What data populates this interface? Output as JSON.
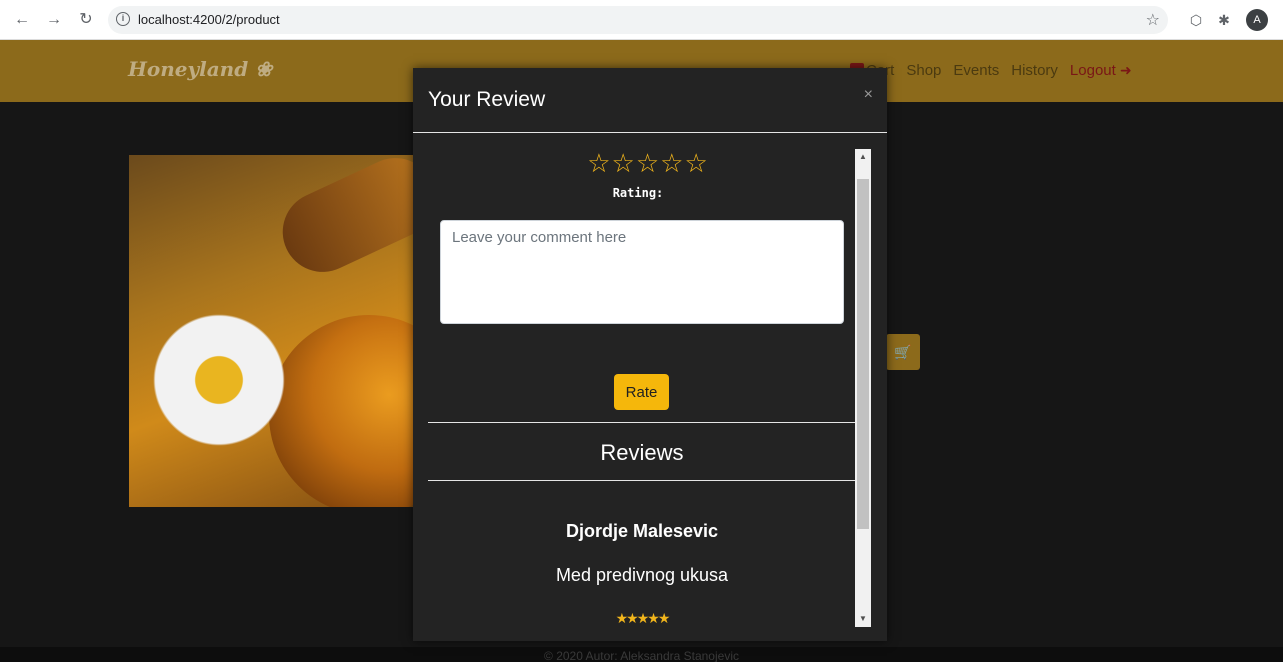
{
  "browser": {
    "url": "localhost:4200/2/product",
    "avatar_letter": "A"
  },
  "site": {
    "logo": "Honeyland",
    "nav": {
      "cart": "Cart",
      "shop": "Shop",
      "events": "Events",
      "history": "History",
      "logout": "Logout"
    },
    "footer": "© 2020 Autor: Aleksandra Stanojevic"
  },
  "modal": {
    "title": "Your Review",
    "close": "×",
    "stars": "☆☆☆☆☆",
    "rating_label": "Rating:",
    "comment_placeholder": "Leave your comment here",
    "rate_button": "Rate",
    "reviews_title": "Reviews",
    "reviews": [
      {
        "author": "Djordje Malesevic",
        "text": "Med predivnog ukusa",
        "rating": 5
      }
    ]
  },
  "colors": {
    "header_bg": "#8c6a1b",
    "accent": "#f5b70b",
    "modal_bg": "#232323"
  }
}
